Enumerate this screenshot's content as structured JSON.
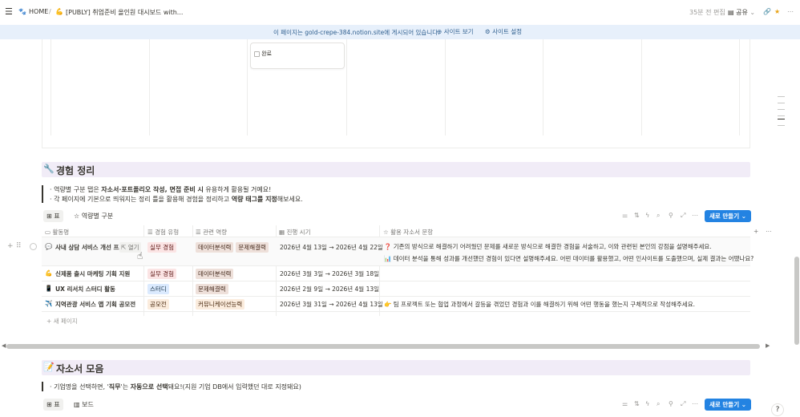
{
  "topbar": {
    "breadcrumb_home": "HOME",
    "separator": "/",
    "page_title": "[PUBLY] 취업준비 올인원 대시보드 with...",
    "edited": "35분 전 편집",
    "share": "공유"
  },
  "banner": {
    "text_prefix": "이 페이지는 ",
    "site": "gold-crepe-384.notion.site",
    "text_suffix": "에 게시되어 있습니다.",
    "view_site": "사이트 보기",
    "site_settings": "사이트 설정"
  },
  "board": {
    "card_label": "완료"
  },
  "experience": {
    "icon": "wrench-icon",
    "title": "경험 정리",
    "quote_line1_parts": [
      "· 역량별 구분 탭은 ",
      "자소서·포트폴리오 작성, 면접 준비 시",
      " 유용하게 활용될 거예요!"
    ],
    "quote_line2_parts": [
      "· 각 페이지에 기본으로 띄워지는 정리 틀을 활용해 경험을 정리하고 ",
      "역량 태그를 지정",
      "해보세요."
    ],
    "views": [
      "표",
      "역량별 구분"
    ],
    "new_button": "새로 만들기",
    "columns": [
      "활동명",
      "경험 유형",
      "관련 역량",
      "진행 시기",
      "활용 자소서 문항"
    ],
    "rows": [
      {
        "icon": "💬",
        "name": "사내 상담 서비스 개선 프로젝트",
        "open": "열기",
        "type": "실무 경험",
        "skills": [
          "데이터분석력",
          "문제해결력"
        ],
        "period": "2026년 4월 13일 → 2026년 4월 22일",
        "questions": [
          {
            "icon": "❓",
            "text": "기존의 방식으로 해결하기 어려웠던 문제를 새로운 방식으로 해결한 경험을 서술하고, 이와 관련된 본인의 강점을 설명해주세요."
          },
          {
            "icon": "📊",
            "text": "데이터 분석을 통해 성과를 개선했던 경험이 있다면 설명해주세요. 어떤 데이터를 활용했고, 어떤 인사이트를 도출했으며, 실제 결과는 어땠나요?"
          }
        ]
      },
      {
        "icon": "💪",
        "name": "신제품 출시 마케팅 기획 지원",
        "type": "실무 경험",
        "skills": [
          "데이터분석력"
        ],
        "period": "2026년 3월 3일 → 2026년 3월 18일",
        "questions": []
      },
      {
        "icon": "📱",
        "name": "UX 리서치 스터디 활동",
        "type": "스터디",
        "skills": [
          "문제해결력"
        ],
        "period": "2026년 2월 9일 → 2026년 4월 13일",
        "questions": []
      },
      {
        "icon": "✈️",
        "name": "지역관광 서비스 앱 기획 공모전",
        "type": "공모전",
        "skills": [
          "커뮤니케이션능력"
        ],
        "period": "2026년 3월 31일 → 2026년 4월 13일",
        "questions": [
          {
            "icon": "👉",
            "text": "팀 프로젝트 또는 협업 과정에서 갈등을 겪었던 경험과 이를 해결하기 위해 어떤 행동을 했는지 구체적으로 작성해주세요."
          }
        ]
      }
    ],
    "new_page": "새 페이지"
  },
  "cover_letter": {
    "icon": "memo-icon",
    "title": "자소서 모음",
    "quote_parts": [
      "· 기업명을 선택하면, '",
      "직무",
      "'는 ",
      "자동으로 선택",
      "돼요!(지원 기업 DB에서 입력했던 대로 지정돼요)"
    ],
    "views": [
      "표",
      "보드"
    ],
    "new_button": "새로 만들기"
  },
  "colors": {
    "accent": "#2383e2",
    "heading_bg": "#f1ecf7",
    "banner_bg": "#e7f0fb"
  }
}
